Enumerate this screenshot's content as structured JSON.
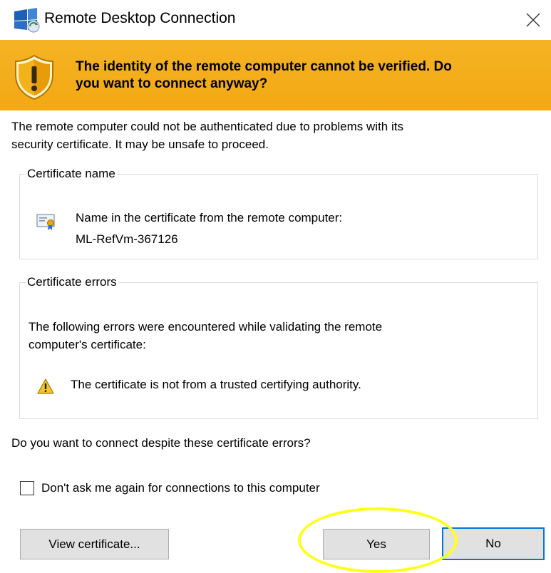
{
  "window": {
    "title": "Remote Desktop Connection",
    "icon": "remote-desktop-icon",
    "close_icon": "close-icon"
  },
  "banner": {
    "icon": "shield-warning-icon",
    "line1": "The identity of the remote computer cannot be verified. Do",
    "line2": "you want to connect anyway?"
  },
  "intro": {
    "line1": "The remote computer could not be authenticated due to problems with its",
    "line2": "security certificate. It may be unsafe to proceed."
  },
  "certificate_name": {
    "legend": "Certificate name",
    "icon": "certificate-icon",
    "line1": "Name in the certificate from the remote computer:",
    "line2": "ML-RefVm-367126"
  },
  "certificate_errors": {
    "legend": "Certificate errors",
    "intro_line1": "The following errors were encountered while validating the remote",
    "intro_line2": "computer's certificate:",
    "icon": "warning-icon",
    "errors": [
      "The certificate is not from a trusted certifying authority."
    ]
  },
  "question": "Do you want to connect despite these certificate errors?",
  "checkbox": {
    "label": "Don't ask me again for connections to this computer",
    "checked": false
  },
  "buttons": {
    "view_certificate": "View certificate...",
    "yes": "Yes",
    "no": "No"
  },
  "colors": {
    "banner": "#f3a814",
    "focus_border": "#0078d7",
    "highlight": "#ffff1a"
  }
}
